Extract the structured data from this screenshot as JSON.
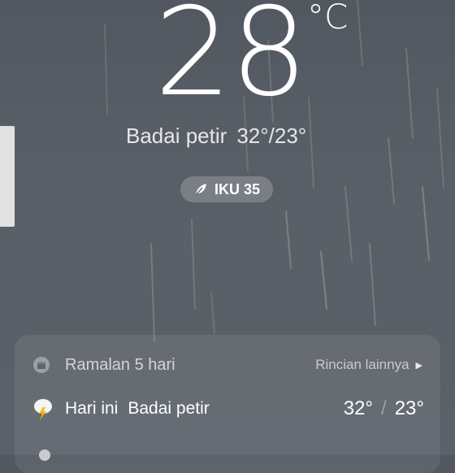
{
  "current": {
    "temperature": "28",
    "unit": "°C",
    "condition": "Badai petir",
    "high_low": "32°/23°"
  },
  "aqi": {
    "label": "IKU 35",
    "icon": "leaf-icon"
  },
  "forecast": {
    "title": "Ramalan 5 hari",
    "more_label": "Rincian lainnya",
    "icon": "calendar-icon",
    "days": [
      {
        "day": "Hari ini",
        "condition": "Badai petir",
        "icon": "thunderstorm-icon",
        "high": "32°",
        "separator": "/",
        "low": "23°"
      }
    ]
  }
}
